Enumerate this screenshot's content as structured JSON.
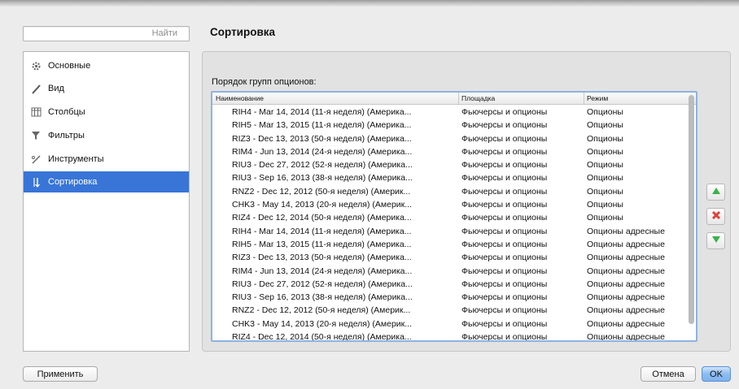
{
  "search": {
    "placeholder": "Найти"
  },
  "page_title": "Сортировка",
  "sidebar": {
    "items": [
      {
        "label": "Основные",
        "icon": "gear-icon"
      },
      {
        "label": "Вид",
        "icon": "brush-icon"
      },
      {
        "label": "Столбцы",
        "icon": "columns-icon"
      },
      {
        "label": "Фильтры",
        "icon": "filter-icon"
      },
      {
        "label": "Инструменты",
        "icon": "tools-icon"
      },
      {
        "label": "Сортировка",
        "icon": "sort-icon",
        "selected": true
      }
    ]
  },
  "section_label": "Порядок групп опционов:",
  "table": {
    "headers": [
      "Наименование",
      "Площадка",
      "Режим"
    ],
    "rows": [
      [
        "RIH4 - Mar 14, 2014 (11-я неделя) (Америка...",
        "Фьючерсы и опционы",
        "Опционы"
      ],
      [
        "RIH5 - Mar 13, 2015 (11-я неделя) (Америка...",
        "Фьючерсы и опционы",
        "Опционы"
      ],
      [
        "RIZ3 - Dec 13, 2013 (50-я неделя) (Америка...",
        "Фьючерсы и опционы",
        "Опционы"
      ],
      [
        "RIM4 - Jun 13, 2014 (24-я неделя) (Америка...",
        "Фьючерсы и опционы",
        "Опционы"
      ],
      [
        "RIU3 - Dec 27, 2012 (52-я неделя) (Америка...",
        "Фьючерсы и опционы",
        "Опционы"
      ],
      [
        "RIU3 - Sep 16, 2013 (38-я неделя) (Америка...",
        "Фьючерсы и опционы",
        "Опционы"
      ],
      [
        "RNZ2 - Dec 12, 2012 (50-я неделя) (Америк...",
        "Фьючерсы и опционы",
        "Опционы"
      ],
      [
        "CHK3 - May 14, 2013 (20-я неделя) (Америк...",
        "Фьючерсы и опционы",
        "Опционы"
      ],
      [
        "RIZ4 - Dec 12, 2014 (50-я неделя) (Америка...",
        "Фьючерсы и опционы",
        "Опционы"
      ],
      [
        "RIH4 - Mar 14, 2014 (11-я неделя) (Америка...",
        "Фьючерсы и опционы",
        "Опционы адресные"
      ],
      [
        "RIH5 - Mar 13, 2015 (11-я неделя) (Америка...",
        "Фьючерсы и опционы",
        "Опционы адресные"
      ],
      [
        "RIZ3 - Dec 13, 2013 (50-я неделя) (Америка...",
        "Фьючерсы и опционы",
        "Опционы адресные"
      ],
      [
        "RIM4 - Jun 13, 2014 (24-я неделя) (Америка...",
        "Фьючерсы и опционы",
        "Опционы адресные"
      ],
      [
        "RIU3 - Dec 27, 2012 (52-я неделя) (Америка...",
        "Фьючерсы и опционы",
        "Опционы адресные"
      ],
      [
        "RIU3 - Sep 16, 2013 (38-я неделя) (Америка...",
        "Фьючерсы и опционы",
        "Опционы адресные"
      ],
      [
        "RNZ2 - Dec 12, 2012 (50-я неделя) (Америк...",
        "Фьючерсы и опционы",
        "Опционы адресные"
      ],
      [
        "CHK3 - May 14, 2013 (20-я неделя) (Америк...",
        "Фьючерсы и опционы",
        "Опционы адресные"
      ],
      [
        "RIZ4 - Dec 12, 2014 (50-я неделя) (Америка...",
        "Фьючерсы и опционы",
        "Опционы адресные"
      ]
    ]
  },
  "side_buttons": {
    "up_icon": "arrow-up-icon",
    "delete_icon": "delete-x-icon",
    "down_icon": "arrow-down-icon"
  },
  "buttons": {
    "apply": "Применить",
    "cancel": "Отмена",
    "ok": "OK"
  },
  "colors": {
    "selection": "#3875d7",
    "up_arrow": "#3bb34a",
    "delete": "#e2403a",
    "focus_ring": "#8fb2e0"
  }
}
